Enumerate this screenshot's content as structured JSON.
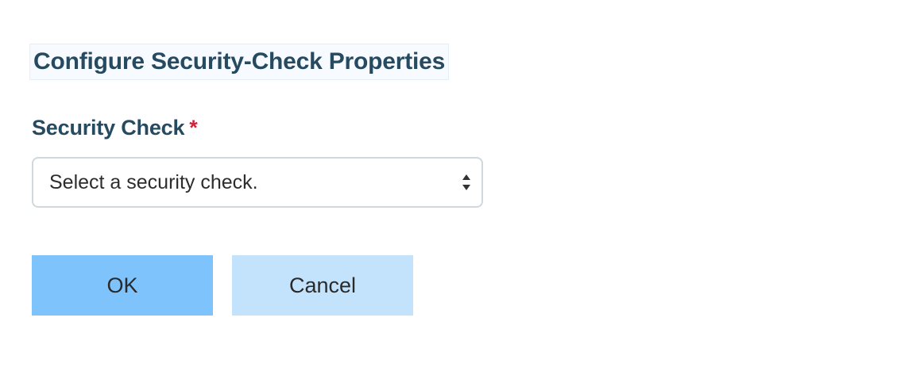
{
  "dialog": {
    "title": "Configure Security-Check Properties",
    "field": {
      "label": "Security Check",
      "required_marker": "*",
      "select_value": "Select a security check.",
      "arrows_icon": "up-down-chevron-icon"
    },
    "buttons": {
      "ok_label": "OK",
      "cancel_label": "Cancel"
    }
  },
  "colors": {
    "heading": "#264a60",
    "required": "#d0243a",
    "primary_button": "#7ec3fb",
    "secondary_button": "#c3e3fc"
  }
}
